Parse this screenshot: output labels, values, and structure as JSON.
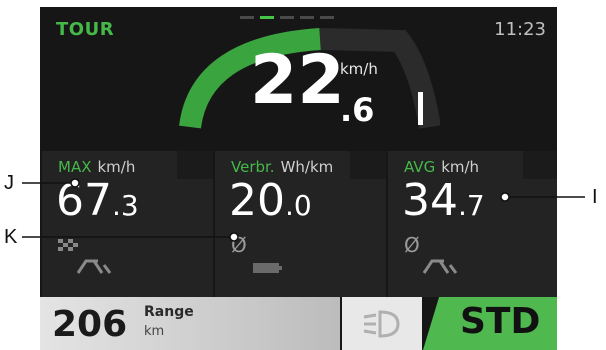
{
  "header": {
    "mode": "TOUR",
    "time": "11:23"
  },
  "speed": {
    "integer": "22",
    "decimal": ".6",
    "unit": "km/h"
  },
  "tiles": [
    {
      "label": "MAX",
      "unit": "km/h",
      "value_int": "67",
      "value_dec": ".3"
    },
    {
      "label": "Verbr.",
      "unit": "Wh/km",
      "value_int": "20",
      "value_dec": ".0",
      "symbol": "Ø"
    },
    {
      "label": "AVG",
      "unit": "km/h",
      "value_int": "34",
      "value_dec": ".7",
      "symbol": "Ø"
    }
  ],
  "bottom": {
    "range_value": "206",
    "range_label": "Range",
    "range_unit": "km",
    "assist_mode": "STD"
  },
  "callouts": {
    "j": "J",
    "k": "K",
    "i": "I"
  },
  "colors": {
    "accent": "#46b84a",
    "screen_bg": "#161616",
    "tile_bg": "#232323"
  },
  "icons": [
    "page-indicator",
    "speed-arc",
    "checkered-flag-icon",
    "bike-icon",
    "battery-icon",
    "headlight-icon"
  ]
}
